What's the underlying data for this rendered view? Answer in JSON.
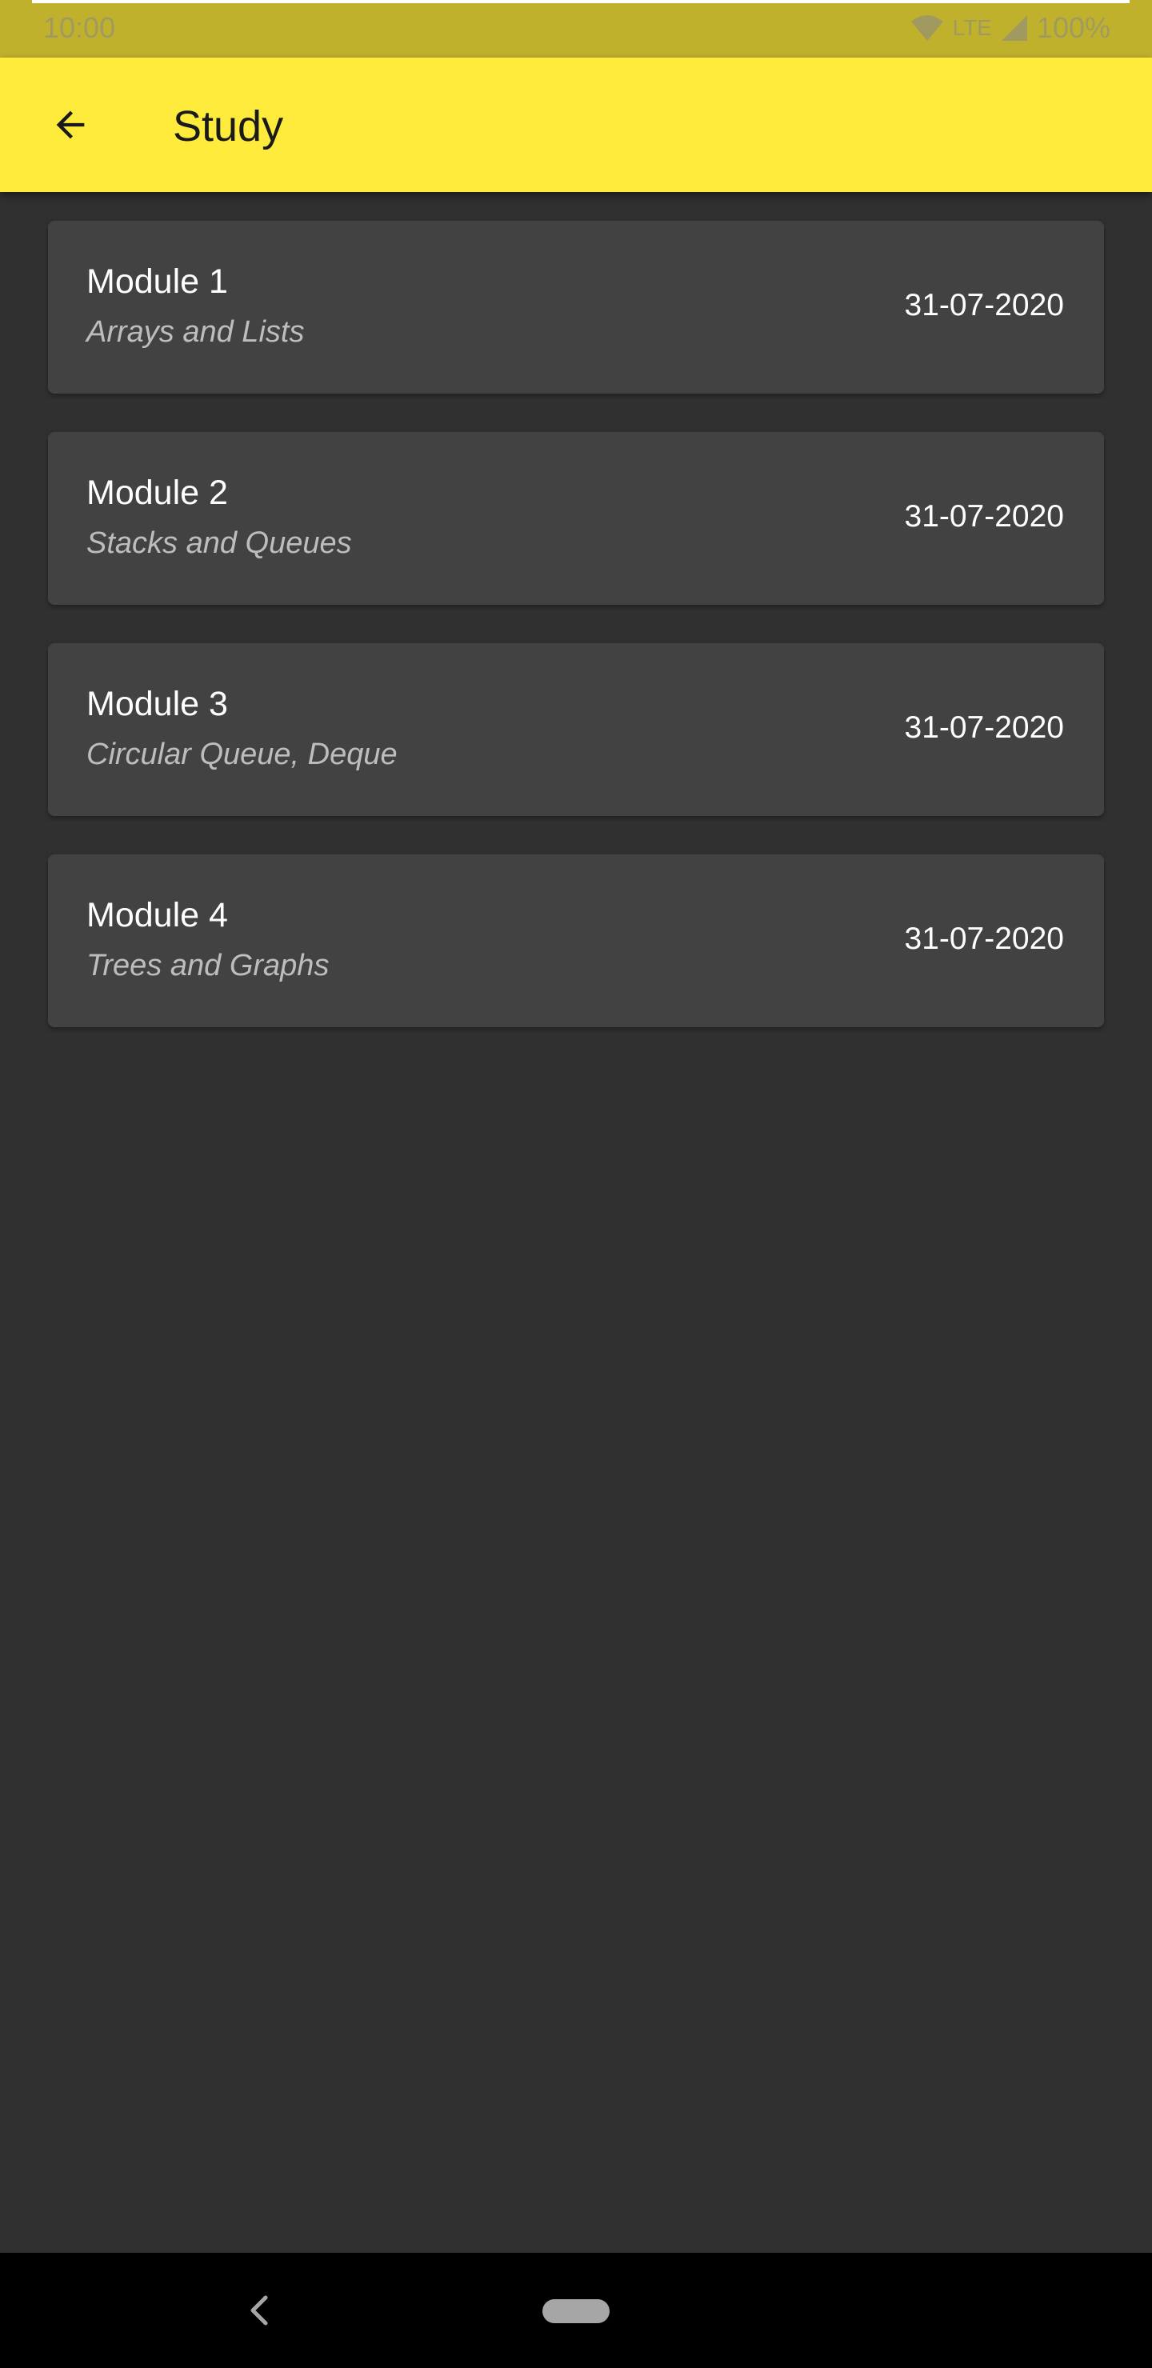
{
  "status_bar": {
    "time": "10:00",
    "network": "LTE",
    "battery": "100%"
  },
  "app_bar": {
    "title": "Study",
    "background_color": "#ffeb3b",
    "back_icon": "arrow-left-icon"
  },
  "modules": [
    {
      "title": "Module 1",
      "subtitle": "Arrays and Lists",
      "date": "31-07-2020"
    },
    {
      "title": "Module 2",
      "subtitle": "Stacks and Queues",
      "date": "31-07-2020"
    },
    {
      "title": "Module 3",
      "subtitle": "Circular Queue, Deque",
      "date": "31-07-2020"
    },
    {
      "title": "Module 4",
      "subtitle": "Trees and Graphs",
      "date": "31-07-2020"
    }
  ],
  "colors": {
    "background": "#303030",
    "card": "#424242",
    "status_bar": "#c0b12d"
  },
  "nav_bar": {
    "back_icon": "chevron-left-icon",
    "home_icon": "home-pill-icon"
  }
}
